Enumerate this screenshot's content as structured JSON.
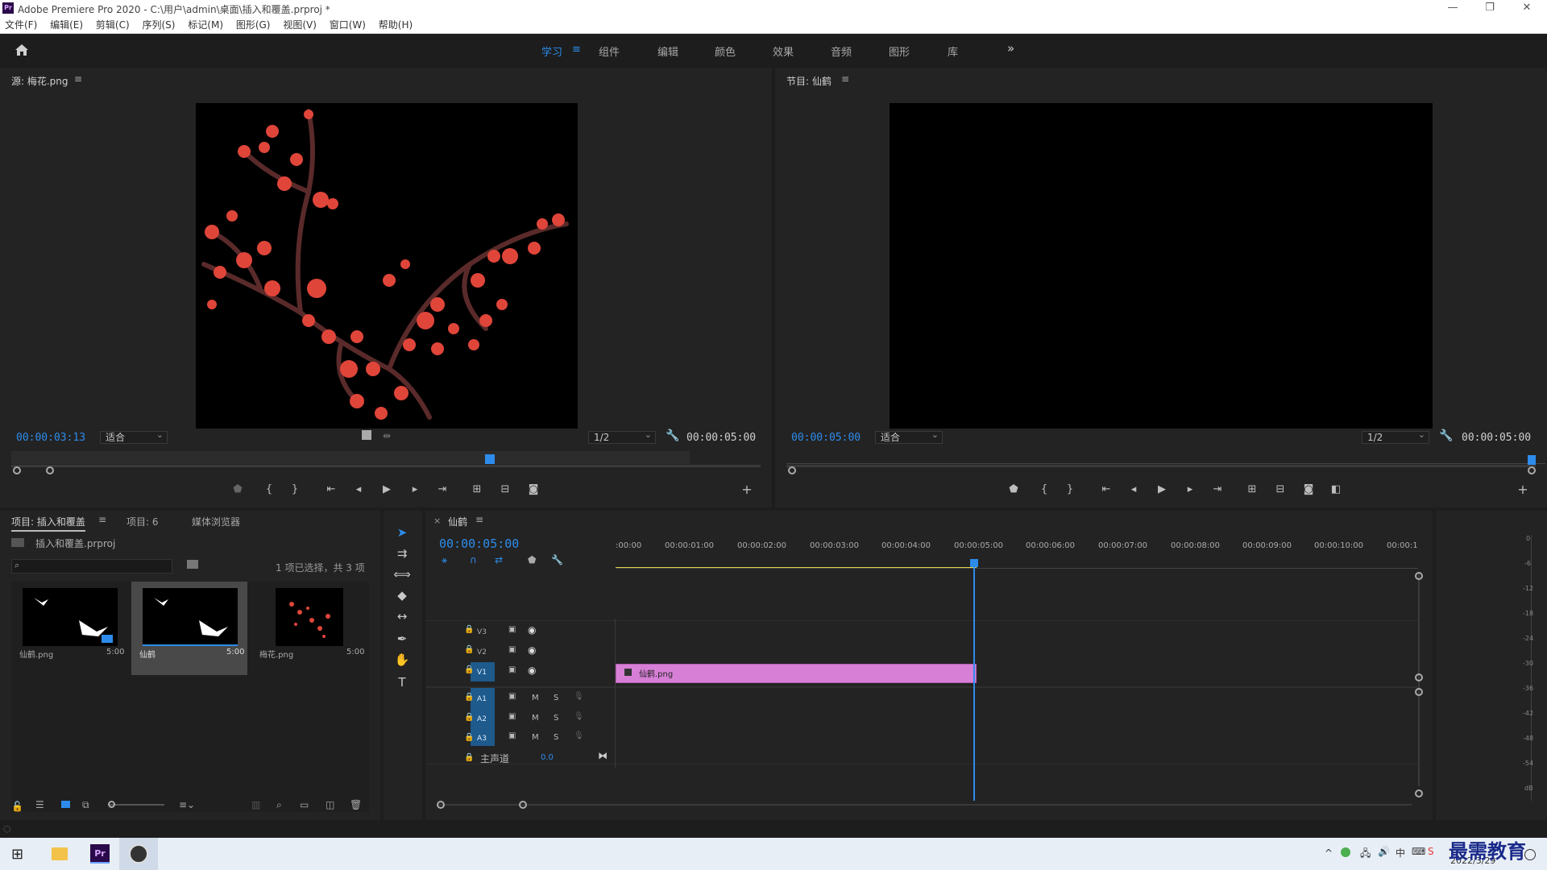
{
  "window": {
    "logo": "Pr",
    "title": "Adobe Premiere Pro 2020 - C:\\用户\\admin\\桌面\\插入和覆盖.prproj *",
    "minimize": "—",
    "maximize": "❐",
    "close": "✕"
  },
  "menu": [
    "文件(F)",
    "编辑(E)",
    "剪辑(C)",
    "序列(S)",
    "标记(M)",
    "图形(G)",
    "视图(V)",
    "窗口(W)",
    "帮助(H)"
  ],
  "workspaces": {
    "tabs": [
      "学习",
      "组件",
      "编辑",
      "颜色",
      "效果",
      "音频",
      "图形",
      "库"
    ],
    "active": "学习",
    "more": "»"
  },
  "source_monitor": {
    "title": "源: 梅花.png",
    "timecode": "00:00:03:13",
    "fit": "适合",
    "resolution": "1/2",
    "duration": "00:00:05:00"
  },
  "program_monitor": {
    "title": "节目: 仙鹤",
    "timecode": "00:00:05:00",
    "fit": "适合",
    "resolution": "1/2",
    "duration": "00:00:05:00"
  },
  "project_panel": {
    "tabs": [
      "项目: 插入和覆盖",
      "项目: 6",
      "媒体浏览器"
    ],
    "file": "插入和覆盖.prproj",
    "selection_info": "1 项已选择，共 3 项",
    "items": [
      {
        "name": "仙鹤.png",
        "duration": "5:00"
      },
      {
        "name": "仙鹤",
        "duration": "5:00"
      },
      {
        "name": "梅花.png",
        "duration": "5:00"
      }
    ]
  },
  "timeline": {
    "close": "×",
    "sequence": "仙鹤",
    "timecode": "00:00:05:00",
    "ruler": ":00:00",
    "ruler_labels": [
      ":00:00",
      "00:00:01:00",
      "00:00:02:00",
      "00:00:03:00",
      "00:00:04:00",
      "00:00:05:00",
      "00:00:06:00",
      "00:00:07:00",
      "00:00:08:00",
      "00:00:09:00",
      "00:00:10:00",
      "00:00:1"
    ],
    "video_tracks": [
      "V3",
      "V2",
      "V1"
    ],
    "audio_tracks": [
      "A1",
      "A2",
      "A3"
    ],
    "mute": "M",
    "solo": "S",
    "master_label": "主声道",
    "master_value": "0.0",
    "clip_name": "仙鹤.png",
    "clip_color": "#d77fd6"
  },
  "audio_meter": [
    "0",
    "-6",
    "-12",
    "-18",
    "-24",
    "-30",
    "-36",
    "-42",
    "-48",
    "-54",
    "dB"
  ],
  "taskbar": {
    "date": "2022/3/29",
    "watermark": "最需教育",
    "pr_label": "Pr"
  }
}
